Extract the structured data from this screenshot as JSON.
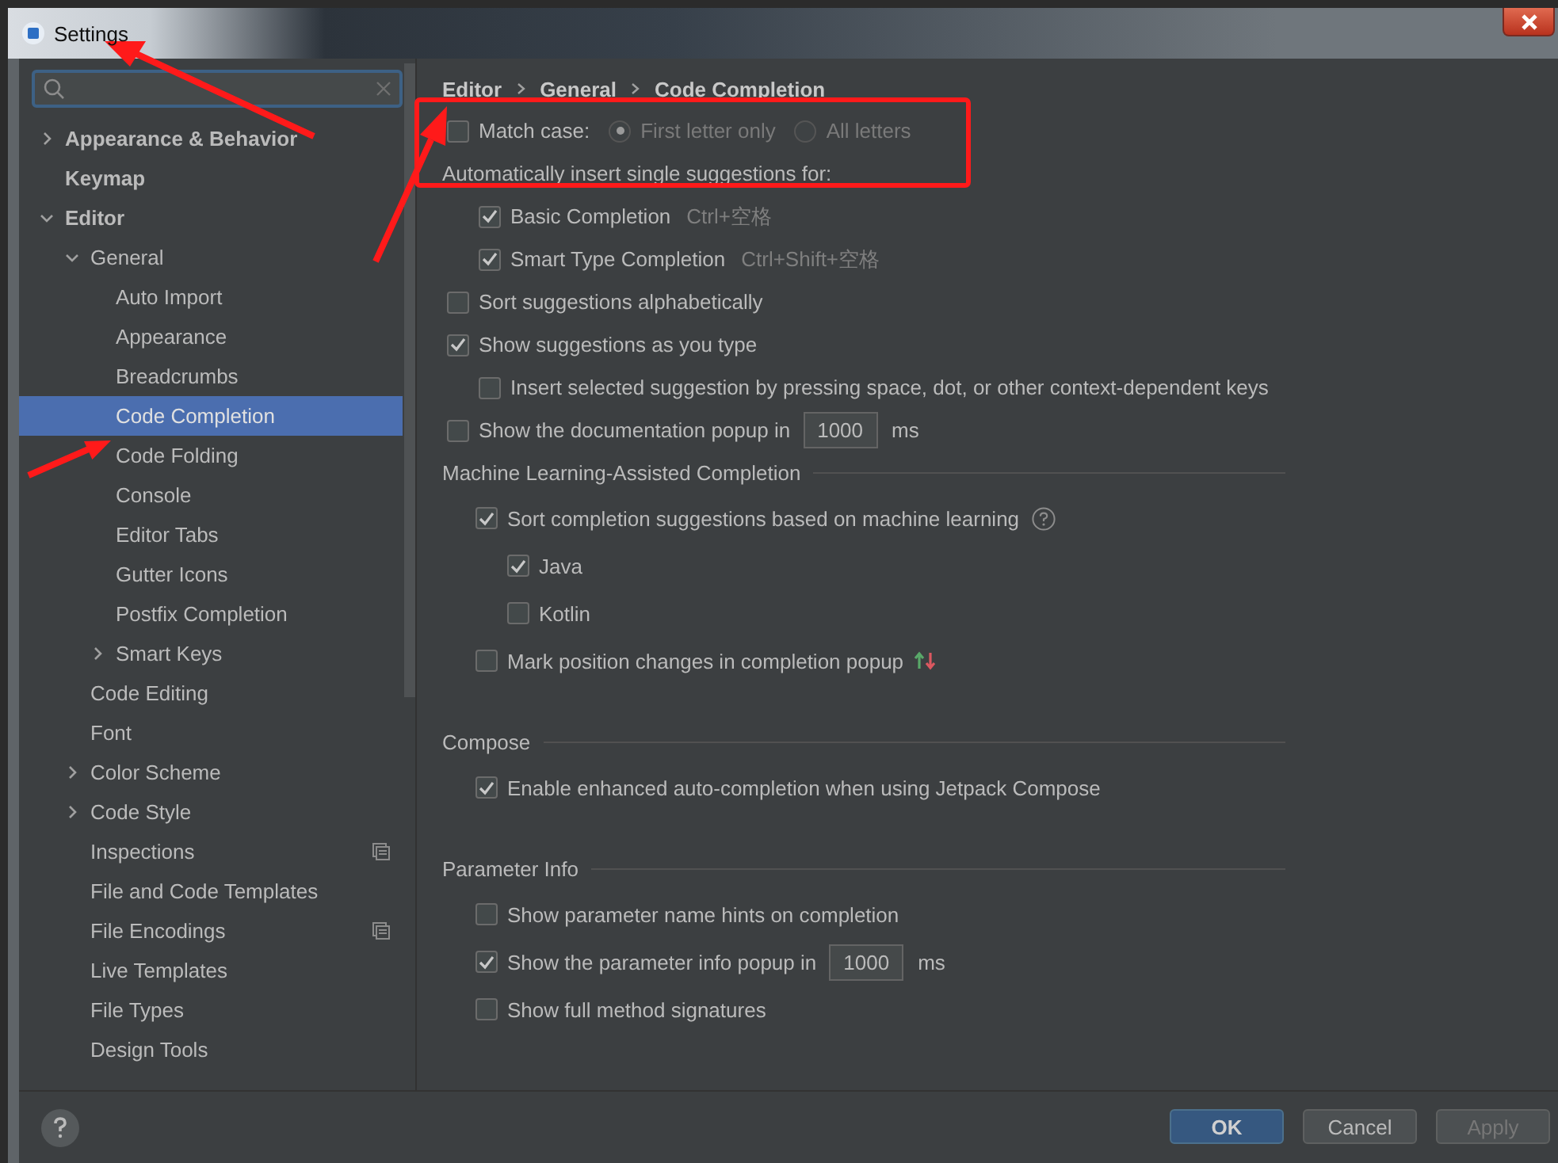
{
  "window": {
    "title": "Settings"
  },
  "sidebar": {
    "items": [
      {
        "label": "Appearance & Behavior",
        "expanded": false,
        "selected": false,
        "project_scope": false
      },
      {
        "label": "Keymap",
        "selected": false,
        "project_scope": false
      },
      {
        "label": "Editor",
        "expanded": true,
        "selected": false,
        "project_scope": false,
        "children": [
          {
            "label": "General",
            "expanded": true,
            "selected": false,
            "project_scope": false,
            "children": [
              {
                "label": "Auto Import",
                "selected": false,
                "project_scope": false
              },
              {
                "label": "Appearance",
                "selected": false,
                "project_scope": false
              },
              {
                "label": "Breadcrumbs",
                "selected": false,
                "project_scope": false
              },
              {
                "label": "Code Completion",
                "selected": true,
                "project_scope": false
              },
              {
                "label": "Code Folding",
                "selected": false,
                "project_scope": false
              },
              {
                "label": "Console",
                "selected": false,
                "project_scope": false
              },
              {
                "label": "Editor Tabs",
                "selected": false,
                "project_scope": false
              },
              {
                "label": "Gutter Icons",
                "selected": false,
                "project_scope": false
              },
              {
                "label": "Postfix Completion",
                "selected": false,
                "project_scope": false
              },
              {
                "label": "Smart Keys",
                "expanded": false,
                "selected": false,
                "project_scope": false
              }
            ]
          },
          {
            "label": "Code Editing",
            "selected": false,
            "project_scope": false
          },
          {
            "label": "Font",
            "selected": false,
            "project_scope": false
          },
          {
            "label": "Color Scheme",
            "expanded": false,
            "selected": false,
            "project_scope": false
          },
          {
            "label": "Code Style",
            "expanded": false,
            "selected": false,
            "project_scope": false
          },
          {
            "label": "Inspections",
            "selected": false,
            "project_scope": true
          },
          {
            "label": "File and Code Templates",
            "selected": false,
            "project_scope": false
          },
          {
            "label": "File Encodings",
            "selected": false,
            "project_scope": true
          },
          {
            "label": "Live Templates",
            "selected": false,
            "project_scope": false
          },
          {
            "label": "File Types",
            "selected": false,
            "project_scope": false
          },
          {
            "label": "Design Tools",
            "selected": false,
            "project_scope": false
          }
        ]
      }
    ]
  },
  "breadcrumb": [
    "Editor",
    "General",
    "Code Completion"
  ],
  "options": [
    {
      "kind": "match_case",
      "label": "Match case:",
      "checked": false,
      "radios": [
        {
          "label": "First letter only",
          "selected": true
        },
        {
          "label": "All letters",
          "selected": false
        }
      ]
    },
    {
      "kind": "text",
      "label": "Automatically insert single suggestions for:",
      "children": [
        {
          "kind": "checkbox",
          "label": "Basic Completion",
          "checked": true,
          "shortcut": "Ctrl+空格"
        },
        {
          "kind": "checkbox",
          "label": "Smart Type Completion",
          "checked": true,
          "shortcut": "Ctrl+Shift+空格"
        }
      ]
    },
    {
      "kind": "checkbox",
      "label": "Sort suggestions alphabetically",
      "checked": false
    },
    {
      "kind": "checkbox",
      "label": "Show suggestions as you type",
      "checked": true,
      "children": [
        {
          "kind": "checkbox",
          "label": "Insert selected suggestion by pressing space, dot, or other context-dependent keys",
          "checked": false
        }
      ]
    },
    {
      "kind": "input",
      "label": "Show the documentation popup in",
      "checked": false,
      "value": "1000",
      "unit": "ms"
    }
  ],
  "sections": [
    {
      "title": "Machine Learning-Assisted Completion",
      "options": [
        {
          "kind": "help_checkbox",
          "label": "Sort completion suggestions based on machine learning",
          "checked": true,
          "children": [
            {
              "kind": "checkbox",
              "label": "Java",
              "checked": true
            },
            {
              "kind": "checkbox",
              "label": "Kotlin",
              "checked": false
            }
          ]
        },
        {
          "kind": "arrows_checkbox",
          "label": "Mark position changes in completion popup",
          "checked": false
        }
      ]
    },
    {
      "title": "Compose",
      "options": [
        {
          "kind": "checkbox",
          "label": "Enable enhanced auto-completion when using Jetpack Compose",
          "checked": true
        }
      ]
    },
    {
      "title": "Parameter Info",
      "options": [
        {
          "kind": "checkbox",
          "label": "Show parameter name hints on completion",
          "checked": false
        },
        {
          "kind": "input",
          "label": "Show the parameter info popup in",
          "checked": true,
          "value": "1000",
          "unit": "ms"
        },
        {
          "kind": "checkbox",
          "label": "Show full method signatures",
          "checked": false
        }
      ]
    }
  ],
  "buttons": [
    {
      "label": "OK",
      "default": true,
      "disabled": false
    },
    {
      "label": "Cancel",
      "default": false,
      "disabled": false
    },
    {
      "label": "Apply",
      "default": false,
      "disabled": true
    }
  ]
}
